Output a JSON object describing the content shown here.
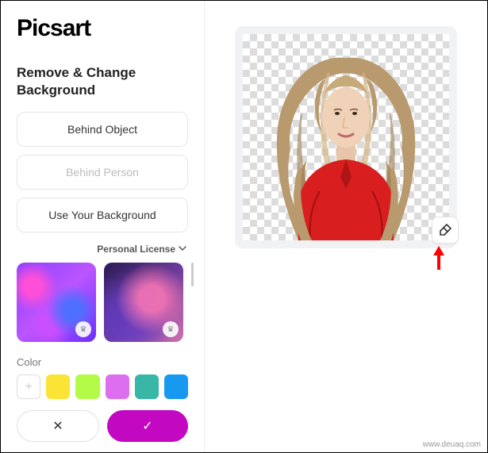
{
  "brand": "Picsart",
  "section_title": "Remove & Change Background",
  "options": {
    "behind_object": "Behind Object",
    "behind_person": "Behind Person",
    "use_background": "Use Your Background"
  },
  "license": {
    "label": "Personal License"
  },
  "color": {
    "label": "Color",
    "swatches": [
      {
        "name": "add",
        "hex": "#ffffff"
      },
      {
        "name": "yellow",
        "hex": "#fce437"
      },
      {
        "name": "lime",
        "hex": "#b4fb48"
      },
      {
        "name": "magenta",
        "hex": "#de6ef0"
      },
      {
        "name": "teal",
        "hex": "#38b7a6"
      },
      {
        "name": "blue",
        "hex": "#1799f1"
      }
    ]
  },
  "actions": {
    "cancel": "✕",
    "confirm": "✓"
  },
  "watermark": "www.deuaq.com"
}
